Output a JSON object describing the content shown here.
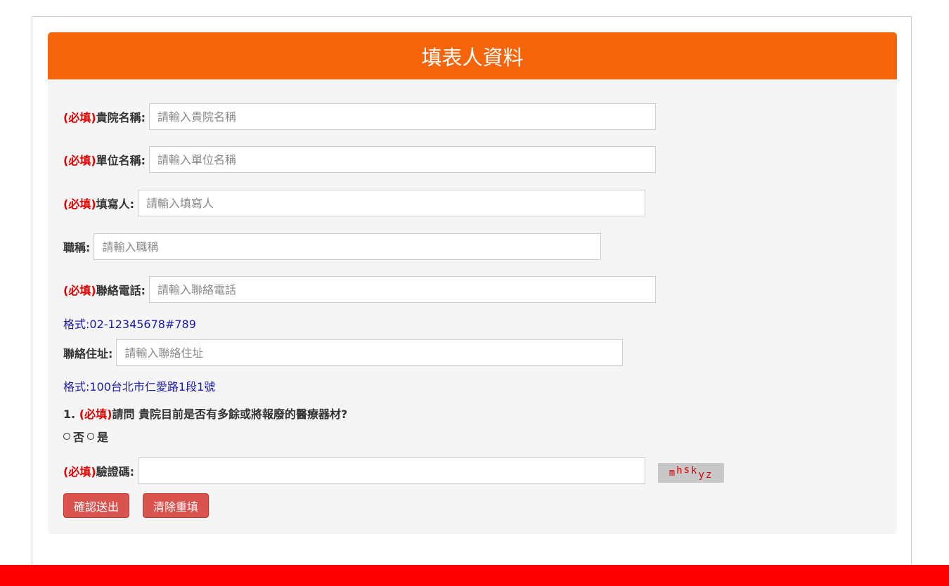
{
  "form": {
    "title": "填表人資料",
    "required_mark": "(必填)",
    "fields": {
      "hospital_name": {
        "label": "貴院名稱:",
        "placeholder": "請輸入貴院名稱"
      },
      "unit_name": {
        "label": "單位名稱:",
        "placeholder": "請輸入單位名稱"
      },
      "filler": {
        "label": "填寫人:",
        "placeholder": "請輸入填寫人"
      },
      "job_title": {
        "label": "職稱:",
        "placeholder": "請輸入職稱"
      },
      "phone": {
        "label": "聯絡電話:",
        "placeholder": "請輸入聯絡電話",
        "hint": "格式:02-12345678#789"
      },
      "address": {
        "label": "聯絡住址:",
        "placeholder": "請輸入聯絡住址",
        "hint": "格式:100台北市仁愛路1段1號"
      },
      "captcha": {
        "label": "驗證碼:",
        "value": "",
        "image_text": [
          "m",
          "h",
          "s",
          "k",
          "y",
          "z"
        ]
      }
    },
    "question": {
      "number": "1.",
      "text": "請問 貴院目前是否有多餘或將報廢的醫療器材?",
      "options": [
        "否",
        "是"
      ]
    },
    "buttons": {
      "submit": "確認送出",
      "reset": "清除重填"
    }
  },
  "colors": {
    "header": "#f7650a",
    "required": "#e00000",
    "hint": "#1a1aad",
    "button": "#d9534f",
    "footer": "#ff0000"
  }
}
